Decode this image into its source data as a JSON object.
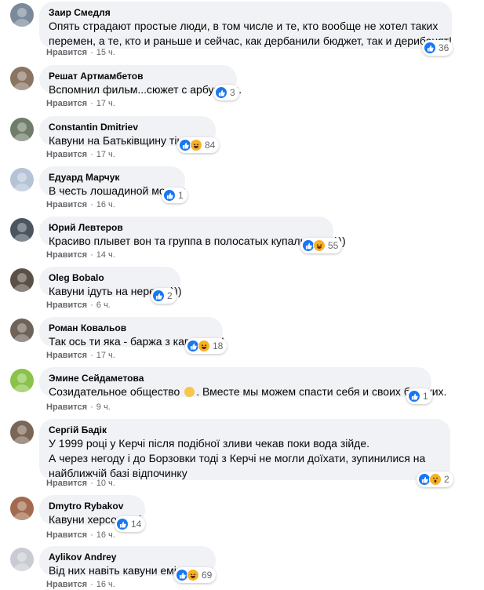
{
  "like_label": "Нравится",
  "dot": "·",
  "comments": [
    {
      "author": "Заир Смедля",
      "lines": [
        "Опять страдают простые люди, в том числе и те, кто вообще не хотел таких",
        "перемен, а те, кто и раньше и сейчас, как дербанили бюджет, так и дерибанят!"
      ],
      "time": "15 ч.",
      "reactions": [
        "like"
      ],
      "count": "36"
    },
    {
      "author": "Решат Артмамбетов",
      "lines": [
        "Вспомнил фильм...сюжет с арбузами."
      ],
      "time": "17 ч.",
      "reactions": [
        "like"
      ],
      "count": "3"
    },
    {
      "author": "Constantin Dmitriev",
      "lines": [
        "Кавуни на Батьківщину тікають..."
      ],
      "time": "17 ч.",
      "reactions": [
        "like",
        "haha"
      ],
      "count": "84"
    },
    {
      "author": "Едуард Марчук",
      "lines": [
        "В честь лошадиной морды"
      ],
      "time": "16 ч.",
      "reactions": [
        "like"
      ],
      "count": "1"
    },
    {
      "author": "Юрий Левтеров",
      "lines": [
        "Красиво плывет вон та группа в полосатых купальниках)))"
      ],
      "time": "14 ч.",
      "reactions": [
        "like",
        "haha"
      ],
      "count": "55"
    },
    {
      "author": "Oleg Bobalo",
      "lines": [
        "Кавуни ідуть на нерест. )))"
      ],
      "time": "6 ч.",
      "reactions": [
        "like"
      ],
      "count": "2"
    },
    {
      "author": "Роман Ковальов",
      "lines": [
        "Так ось ти яка - баржа з кавунами!"
      ],
      "time": "17 ч.",
      "reactions": [
        "like",
        "haha"
      ],
      "count": "18"
    },
    {
      "author": "Эмине Сейдаметова",
      "lines": [
        "Созидательное общество . Вместе мы можем спасти себя и своих близких."
      ],
      "time": "9 ч.",
      "reactions": [
        "like"
      ],
      "count": "1"
    },
    {
      "author": "Сергій Бадік",
      "lines": [
        "У 1999 році у Керчі після подібної зливи чекав поки вода зійде.",
        "А через негоду і до Борзовки тоді з Керчі не могли доїхати, зупинилися на",
        "найближчій базі відпочинку"
      ],
      "time": "10 ч.",
      "reactions": [
        "like",
        "wow"
      ],
      "count": "2"
    },
    {
      "author": "Dmytro Rybakov",
      "lines": [
        "Кавуни херсонські"
      ],
      "time": "16 ч.",
      "reactions": [
        "like"
      ],
      "count": "14"
    },
    {
      "author": "Aylikov Andrey",
      "lines": [
        "Від них навіть кавуни емігрують."
      ],
      "time": "16 ч.",
      "reactions": [
        "like",
        "haha"
      ],
      "count": "69"
    }
  ],
  "colors": {
    "bubble": "#f0f2f5",
    "like": "#1877f2",
    "haha": "#f7b125",
    "meta": "#65676b"
  }
}
